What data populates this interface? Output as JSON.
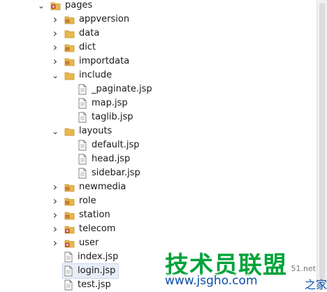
{
  "tree": {
    "root": {
      "label": "pages",
      "expanded": true,
      "icon": "package-folder-icon"
    },
    "items": [
      {
        "label": "appversion",
        "type": "folder",
        "icon": "package-folder-icon",
        "expanded": false,
        "depth": 1
      },
      {
        "label": "data",
        "type": "folder",
        "icon": "folder-icon",
        "expanded": false,
        "depth": 1
      },
      {
        "label": "dict",
        "type": "folder",
        "icon": "package-folder-icon",
        "expanded": false,
        "depth": 1
      },
      {
        "label": "importdata",
        "type": "folder",
        "icon": "package-folder-icon",
        "expanded": false,
        "depth": 1
      },
      {
        "label": "include",
        "type": "folder",
        "icon": "folder-icon",
        "expanded": true,
        "depth": 1
      },
      {
        "label": "_paginate.jsp",
        "type": "file",
        "icon": "jsp-file-icon",
        "depth": 2
      },
      {
        "label": "map.jsp",
        "type": "file",
        "icon": "jsp-file-icon",
        "depth": 2
      },
      {
        "label": "taglib.jsp",
        "type": "file",
        "icon": "jsp-file-icon",
        "depth": 2
      },
      {
        "label": "layouts",
        "type": "folder",
        "icon": "folder-icon",
        "expanded": true,
        "depth": 1
      },
      {
        "label": "default.jsp",
        "type": "file",
        "icon": "jsp-file-icon",
        "depth": 2
      },
      {
        "label": "head.jsp",
        "type": "file",
        "icon": "jsp-file-icon",
        "depth": 2
      },
      {
        "label": "sidebar.jsp",
        "type": "file",
        "icon": "jsp-file-icon",
        "depth": 2
      },
      {
        "label": "newmedia",
        "type": "folder",
        "icon": "package-folder-icon",
        "expanded": false,
        "depth": 1
      },
      {
        "label": "role",
        "type": "folder",
        "icon": "package-folder-icon",
        "expanded": false,
        "depth": 1
      },
      {
        "label": "station",
        "type": "folder",
        "icon": "package-folder-icon",
        "expanded": false,
        "depth": 1
      },
      {
        "label": "telecom",
        "type": "folder",
        "icon": "error-folder-icon",
        "expanded": false,
        "depth": 1
      },
      {
        "label": "user",
        "type": "folder",
        "icon": "error-folder-icon",
        "expanded": false,
        "depth": 1
      },
      {
        "label": "index.jsp",
        "type": "file",
        "icon": "jsp-file-icon",
        "depth": 1
      },
      {
        "label": "login.jsp",
        "type": "file",
        "icon": "jsp-file-icon",
        "depth": 1,
        "selected": true
      },
      {
        "label": "test.jsp",
        "type": "file",
        "icon": "jsp-file-icon",
        "depth": 1
      }
    ]
  },
  "watermark": {
    "brand": "技术员联盟",
    "url": "www.jsgho.com",
    "side_top": "51.net",
    "side_bottom": "之家"
  },
  "colors": {
    "folder": "#e8b84a",
    "folder_dark": "#c9912a",
    "error": "#d23a3a",
    "package": "#d9823a",
    "selection": "#e8eef8",
    "watermark_green": "#00a23a",
    "watermark_blue": "#0a4fa8"
  }
}
